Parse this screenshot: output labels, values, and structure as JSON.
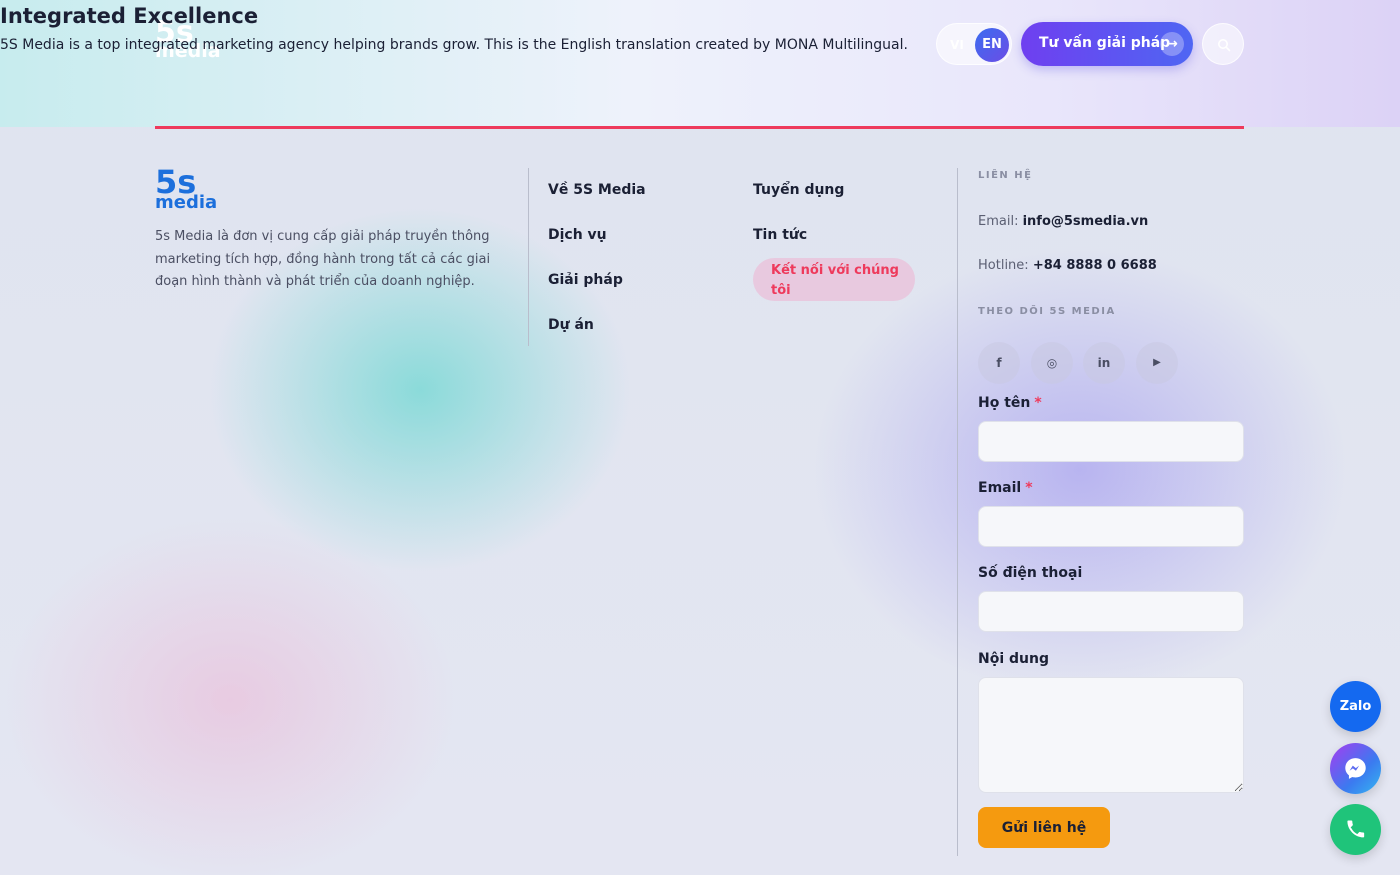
{
  "header": {
    "overlay_title": "Integrated Excellence",
    "overlay_description": "5S Media is a top integrated marketing agency helping brands grow. This is the English translation created by MONA Multilingual.",
    "logo_line1": "5s",
    "logo_line2": "media",
    "lang_vi": "VI",
    "lang_en": "EN",
    "cta_label": "Tư vấn giải pháp",
    "cta_icon": "arrow-right-icon",
    "search_icon": "search-icon",
    "accent_color": "#ee3a5c",
    "cta_color": "#6f3ff0"
  },
  "footer": {
    "logo_line1": "5s",
    "logo_line2": "media",
    "about": "5s Media là đơn vị cung cấp giải pháp truyền thông marketing tích hợp, đồng hành trong tất cả các giai đoạn hình thành và phát triển của doanh nghiệp.",
    "nav_col1": [
      "Về 5S Media",
      "Dịch vụ",
      "Giải pháp",
      "Dự án"
    ],
    "nav_col2": [
      "Tuyển dụng",
      "Tin tức",
      "Kết nối với chúng tôi"
    ],
    "contact": {
      "heading": "LIÊN HỆ",
      "email_label": "Email:",
      "email_value": "info@5smedia.vn",
      "hotline_label": "Hotline:",
      "hotline_value": "+84 8888 0 6688"
    },
    "follow": {
      "heading": "THEO DÕI 5S MEDIA",
      "socials": [
        {
          "icon": "facebook-icon",
          "glyph": "f"
        },
        {
          "icon": "instagram-icon",
          "glyph": "◎"
        },
        {
          "icon": "linkedin-icon",
          "glyph": "in"
        },
        {
          "icon": "youtube-icon",
          "glyph": "▶"
        }
      ]
    },
    "form": {
      "name_label": "Họ tên",
      "email_label": "Email",
      "phone_label": "Số điện thoại",
      "content_label": "Nội dung",
      "required_mark": "*",
      "submit_label": "Gửi liên hệ",
      "submit_color": "#f59a0f"
    }
  },
  "floating": {
    "zalo_label": "Zalo",
    "messenger_icon": "messenger-icon",
    "phone_icon": "phone-icon"
  }
}
